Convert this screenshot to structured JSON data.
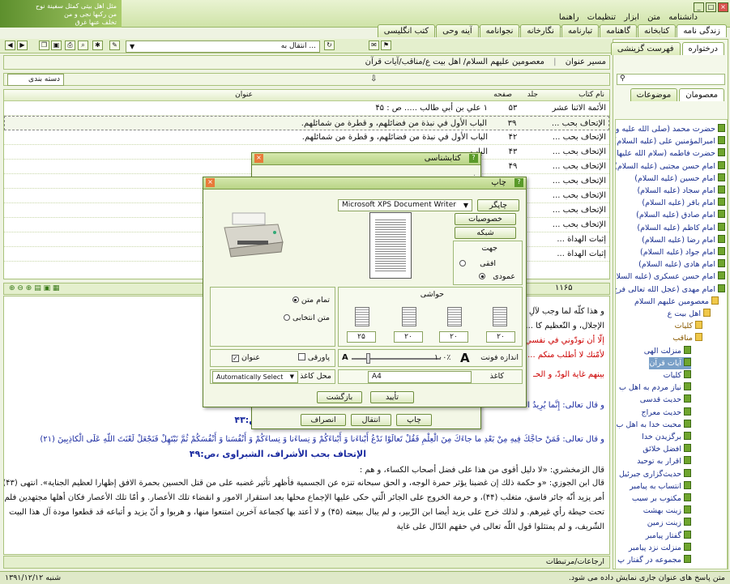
{
  "banner": {
    "line1": "مثل اهل بیتی کمثل سفینة نوح",
    "line2": "من رکبها نجی و من",
    "line3": "تخلف عنها غرق"
  },
  "menu": [
    "دانشنامه",
    "متن",
    "ابزار",
    "تنظیمات",
    "راهنما"
  ],
  "top_tabs": [
    "زندگی نامه",
    "کتابخانه",
    "گاهنامه",
    "تبارنامه",
    "نگارخانه",
    "نجوانامه",
    "آینه وحی",
    "کتب انگلیسی"
  ],
  "toolbar": {
    "goto_placeholder": "انتقال به ..."
  },
  "side_tabs": [
    "درختواره",
    "فهرست گزینشی"
  ],
  "side_subtabs": [
    "معصومان",
    "موضوعات"
  ],
  "path_label": "مسیر عنوان",
  "path_value": "معصومین علیهم السلام/ اهل بیت ع/مناقب/آیات قرآن",
  "category_placeholder": "دسته بندی",
  "grid": {
    "headers": {
      "book": "نام کتاب",
      "vol": "جلد",
      "page": "صفحه",
      "title": "عنوان"
    },
    "rows": [
      {
        "book": "الأئمة الاثنا عشر",
        "vol": "",
        "page": "۵۳",
        "title": "۱ علي بن أبي طالب ..... ص : ۴۵"
      },
      {
        "book": "الإتحاف بحب ...",
        "vol": "",
        "page": "۳۹",
        "title": "الباب الأول في نبذة من فضائلهم، و قطرة من شمائلهم."
      },
      {
        "book": "الإتحاف بحب ...",
        "vol": "",
        "page": "۴۲",
        "title": "الباب الأول في نبذة من فضائلهم، و قطرة من شمائلهم."
      },
      {
        "book": "الإتحاف بحب ...",
        "vol": "",
        "page": "۴۳",
        "title": "الباب"
      },
      {
        "book": "الإتحاف بحب ...",
        "vol": "",
        "page": "۴۹",
        "title": ""
      },
      {
        "book": "الإتحاف بحب ...",
        "vol": "",
        "page": "",
        "title": ""
      },
      {
        "book": "الإتحاف بحب ...",
        "vol": "",
        "page": "",
        "title": ""
      },
      {
        "book": "الإتحاف بحب ...",
        "vol": "",
        "page": "",
        "title": ""
      },
      {
        "book": "الإتحاف بحب ...",
        "vol": "",
        "page": "",
        "title": ""
      },
      {
        "book": "إثبات الهداة ...",
        "vol": "",
        "page": "",
        "title": "ص : ۹۷"
      },
      {
        "book": "إثبات الهداة ...",
        "vol": "",
        "page": "",
        "title": "ص : ۹۷"
      }
    ]
  },
  "count": "۱۱۶۵",
  "tree": [
    {
      "label": "حضرت محمد (صلی الله علیه و",
      "kind": "book"
    },
    {
      "label": "امیرالمؤمنین علی (علیه السلام)",
      "kind": "book"
    },
    {
      "label": "حضرت فاطمه (سلام الله علیها)",
      "kind": "book"
    },
    {
      "label": "امام حسن مجتبی (علیه السلام)",
      "kind": "book"
    },
    {
      "label": "امام حسین (علیه السلام)",
      "kind": "book"
    },
    {
      "label": "امام سجاد (علیه السلام)",
      "kind": "book"
    },
    {
      "label": "امام باقر (علیه السلام)",
      "kind": "book"
    },
    {
      "label": "امام صادق (علیه السلام)",
      "kind": "book"
    },
    {
      "label": "امام کاظم (علیه السلام)",
      "kind": "book"
    },
    {
      "label": "امام رضا (علیه السلام)",
      "kind": "book"
    },
    {
      "label": "امام جواد (علیه السلام)",
      "kind": "book"
    },
    {
      "label": "امام هادی (علیه السلام)",
      "kind": "book"
    },
    {
      "label": "امام حسن عسکری (علیه السلام)",
      "kind": "book"
    },
    {
      "label": "امام مهدی (عجل الله تعالی فرج",
      "kind": "book"
    },
    {
      "label": "معصومین علیهم السلام",
      "kind": "fold"
    },
    {
      "label": "اهل بیت ع",
      "kind": "fold"
    },
    {
      "label": "کلیات",
      "kind": "fold"
    },
    {
      "label": "مناقب",
      "kind": "fold"
    },
    {
      "label": "منزلت الهی",
      "kind": "book"
    },
    {
      "label": "آیات قرآن",
      "kind": "book",
      "hl": true
    },
    {
      "label": "کلیات",
      "kind": "book"
    },
    {
      "label": "نیاز مردم به اهل ب",
      "kind": "book"
    },
    {
      "label": "حدیث قدسی",
      "kind": "book"
    },
    {
      "label": "حدیث معراج",
      "kind": "book"
    },
    {
      "label": "محبت خدا به اهل ب",
      "kind": "book"
    },
    {
      "label": "برگزیدن خدا",
      "kind": "book"
    },
    {
      "label": "افضل خلائق",
      "kind": "book"
    },
    {
      "label": "اقرار به توحید",
      "kind": "book"
    },
    {
      "label": "حدیث‌گزاری جبرئیل",
      "kind": "book"
    },
    {
      "label": "انتساب به پیامبر",
      "kind": "book"
    },
    {
      "label": "مکتوب بر سیب",
      "kind": "book"
    },
    {
      "label": "زینت بهشت",
      "kind": "book"
    },
    {
      "label": "زینت زمین",
      "kind": "book"
    },
    {
      "label": "گفتار پیامبر",
      "kind": "book"
    },
    {
      "label": "منزلت نزد پیامبر",
      "kind": "book"
    },
    {
      "label": "مجموعه در گفتار پ",
      "kind": "book"
    }
  ],
  "text_lines": [
    {
      "t": "و هذا كلّه لما وجب لآلِ محمّد من التّعظيم و الإجلال لحمه، و دمه الكريمين فيهم، فهم بعضه، و بعضه في وجوب",
      "c": ""
    },
    {
      "t": "الإجلال، و التّعظيم كا ... في الْقُرْبى (۳۱) قال ابن عباس: «المعنى لا أسألكم عليه أجرا",
      "c": ""
    },
    {
      "t": "إلّا أن تودّوني في نفسي ... الأنسب ما قاله غيره في تفسير الآية: «إنّ المعنى قل يا محمّد",
      "c": "red"
    },
    {
      "t": "لأمّتك لا أطلب منكم ... و تحبوهم، و تعاملوهم بالمعروف، و الإحسان، و يكون بينكم، و",
      "c": "red"
    },
    {
      "t": "بينهم غاية الودّ، و الحـ",
      "c": "red"
    },
    {
      "t": "و قال تعالى: إِنَّما يُرِيدُ اللّهُ",
      "c": "blue"
    },
    {
      "t": "ص:۴۳",
      "c": "bold"
    },
    {
      "t": "و قال تعالى: فَمَنْ حاجَّكَ فِيهِ مِنْ بَعْدِ ما جاءَكَ مِنَ الْعِلْمِ فَقُلْ تَعالَوْا نَدْعُ أَبْناءَنا وَ أَبْناءَكُمْ وَ نِساءَنا وَ نِساءَكُمْ وَ أَنْفُسَنا وَ أَنْفُسَكُمْ ثُمَّ نَبْتَهِلْ فَنَجْعَلْ لَعْنَتَ اللّهِ عَلَى الْكاذِبِينَ (۲۱)",
      "c": "blue"
    },
    {
      "t": "الإتحاف بحب الأشراف، الشبراوى ،ص:۴۹",
      "c": "bold"
    },
    {
      "t": "قال الزمخشري: «لا دليل أقوى من هذا على فضل أصحاب الكساء، و هم :",
      "c": ""
    },
    {
      "t": "قال ابن الجوزي: «و حكمة ذلك إن غضبنا يؤثر حمرة الوجه، و الحق سبحانه تنزه عن الجسمية فأظهر تأثير غضبه على من قتل الحسين بحمرة الافق إظهارا لعظيم الجناية». انتهى (۴۳) و غاية",
      "c": ""
    },
    {
      "t": "أمر يزيد أنّه جائر فاسق، متغلب (۴۴)، و حرمة الخروج على الجائر الّتي حكى عليها الإجماع محلها بعد استقرار الامور و انقضاء تلك الأعصار. و أمّا تلك الأعصار فكان أهلها مجتهدين فلم يدخلوا",
      "c": ""
    },
    {
      "t": "تحت حيطة رأي غيرهم. و لذلك خرج على يزيد أيضا ابن الزّبير، و لم يبال ببيعته (۴۵) و لا أعتد بها كجماعة آخرين امتنعوا منها، و هربوا و أنّ يزيد و أتباعه قد قطعوا مودة آل هذا البيت",
      "c": ""
    },
    {
      "t": "الشّريف، و لم يمتثلوا قول اللّه تعالى في حقهم الدّال على غاية",
      "c": ""
    }
  ],
  "bottom_label": "ارجاعات/مرتبطات",
  "status": {
    "message": "متن پاسخ های عنوان جاری نمایش داده می شود.",
    "date": "شنبه ۱۳۹۱/۱۲/۱۲"
  },
  "biblio_dialog": {
    "title": "کتابشناسی",
    "lines": [
      "ص:۴۳",
      "ص:۴۹"
    ],
    "buttons": [
      "چاپ",
      "انتقال",
      "انصراف"
    ]
  },
  "print_dialog": {
    "title": "چاپ",
    "printer_label": "چاپگر",
    "printer_value": "Microsoft XPS Document Writer",
    "props_button": "خصوصیات",
    "network_button": "شبکه",
    "orient_label": "جهت",
    "orient_landscape": "افقی",
    "orient_portrait": "عمودی",
    "margins_label": "حواشی",
    "margins": [
      "۲۰",
      "۲۰",
      "۲۰",
      "۲۵"
    ],
    "full_text": "تمام متن",
    "selected_text": "متن انتخابی",
    "font_size_label": "اندازه فونت",
    "font_size_value": "۱۰۰٪",
    "footnote": "پاورقی",
    "title_check": "عنوان",
    "paper_label": "کاغذ",
    "paper_value": "A4",
    "paper_source_label": "محل کاغذ",
    "paper_source_value": "Automatically Select",
    "ok": "تأیید",
    "back": "بازگشت"
  }
}
